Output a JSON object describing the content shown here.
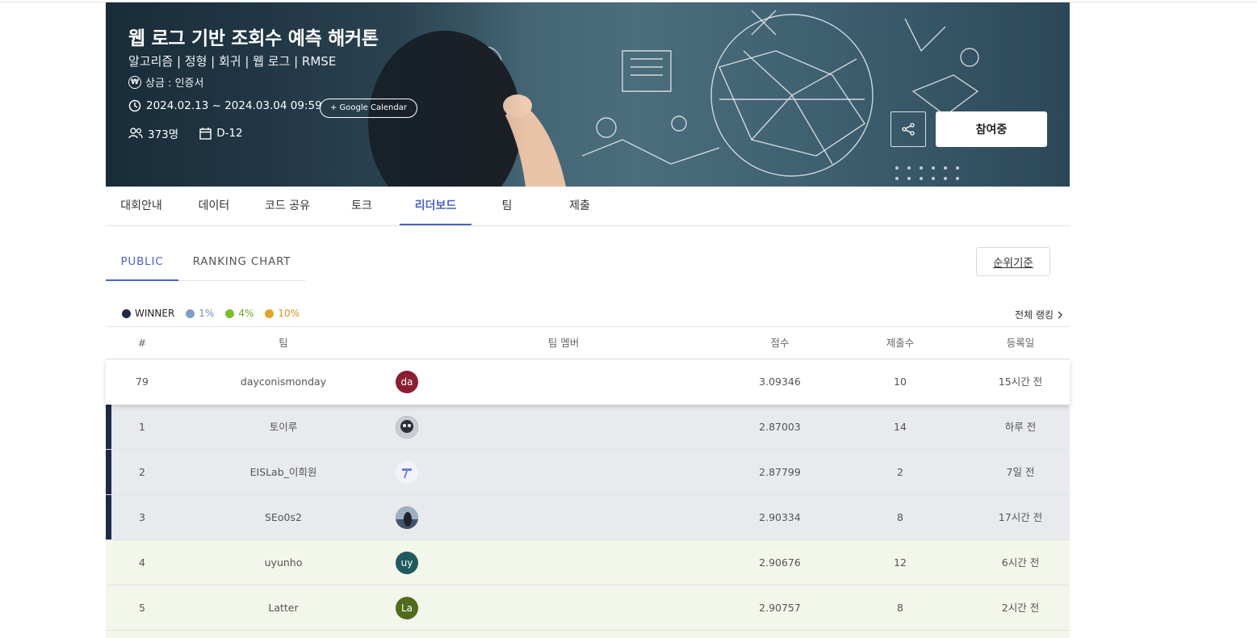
{
  "banner": {
    "title": "웹 로그 기반 조회수 예측 해커톤",
    "tags": "알고리즘 | 정형 | 회귀 | 웹 로그 | RMSE",
    "prize": "상금 : 인증서",
    "period": "2024.02.13 ~ 2024.03.04 09:59",
    "calendar_button": "+ Google Calendar",
    "participants": "373명",
    "dday": "D-12",
    "join_button": "참여중"
  },
  "tabs": [
    "대회안내",
    "데이터",
    "코드 공유",
    "토크",
    "리더보드",
    "팀",
    "제출"
  ],
  "active_tab": "리더보드",
  "subtabs": [
    "PUBLIC",
    "RANKING CHART"
  ],
  "active_subtab": "PUBLIC",
  "rank_basis_button": "순위기준",
  "legend": [
    {
      "label": "WINNER",
      "color": "#1f2a44",
      "text_color": "#222222"
    },
    {
      "label": "1%",
      "color": "#7f9fc3",
      "text_color": "#6f8fb5"
    },
    {
      "label": "4%",
      "color": "#7dbb2f",
      "text_color": "#6aa628"
    },
    {
      "label": "10%",
      "color": "#e0a52a",
      "text_color": "#d4951e"
    }
  ],
  "full_ranking_link": "전체 랭킹",
  "table": {
    "headers": {
      "rank": "#",
      "team": "팀",
      "members": "팀 멤버",
      "score": "점수",
      "submissions": "제출수",
      "date": "등록일"
    },
    "rows": [
      {
        "rank": "79",
        "team": "dayconismonday",
        "avatar": "da",
        "avatar_color": "#8b1e33",
        "score": "3.09346",
        "submissions": "10",
        "date": "15시간 전",
        "tier": "me"
      },
      {
        "rank": "1",
        "team": "토이루",
        "avatar": "",
        "avatar_color": "#3a3f4a",
        "score": "2.87003",
        "submissions": "14",
        "date": "하루 전",
        "tier": "winner"
      },
      {
        "rank": "2",
        "team": "EISLab_이희원",
        "avatar": "",
        "avatar_color": "#f2f4fa",
        "score": "2.87799",
        "submissions": "2",
        "date": "7일 전",
        "tier": "winner"
      },
      {
        "rank": "3",
        "team": "SEo0s2",
        "avatar": "",
        "avatar_color": "#5b6f86",
        "score": "2.90334",
        "submissions": "8",
        "date": "17시간 전",
        "tier": "winner"
      },
      {
        "rank": "4",
        "team": "uyunho",
        "avatar": "uy",
        "avatar_color": "#1f5a5e",
        "score": "2.90676",
        "submissions": "12",
        "date": "6시간 전",
        "tier": "p4"
      },
      {
        "rank": "5",
        "team": "Latter",
        "avatar": "La",
        "avatar_color": "#4f6b1c",
        "score": "2.90757",
        "submissions": "8",
        "date": "2시간 전",
        "tier": "p4"
      }
    ]
  }
}
